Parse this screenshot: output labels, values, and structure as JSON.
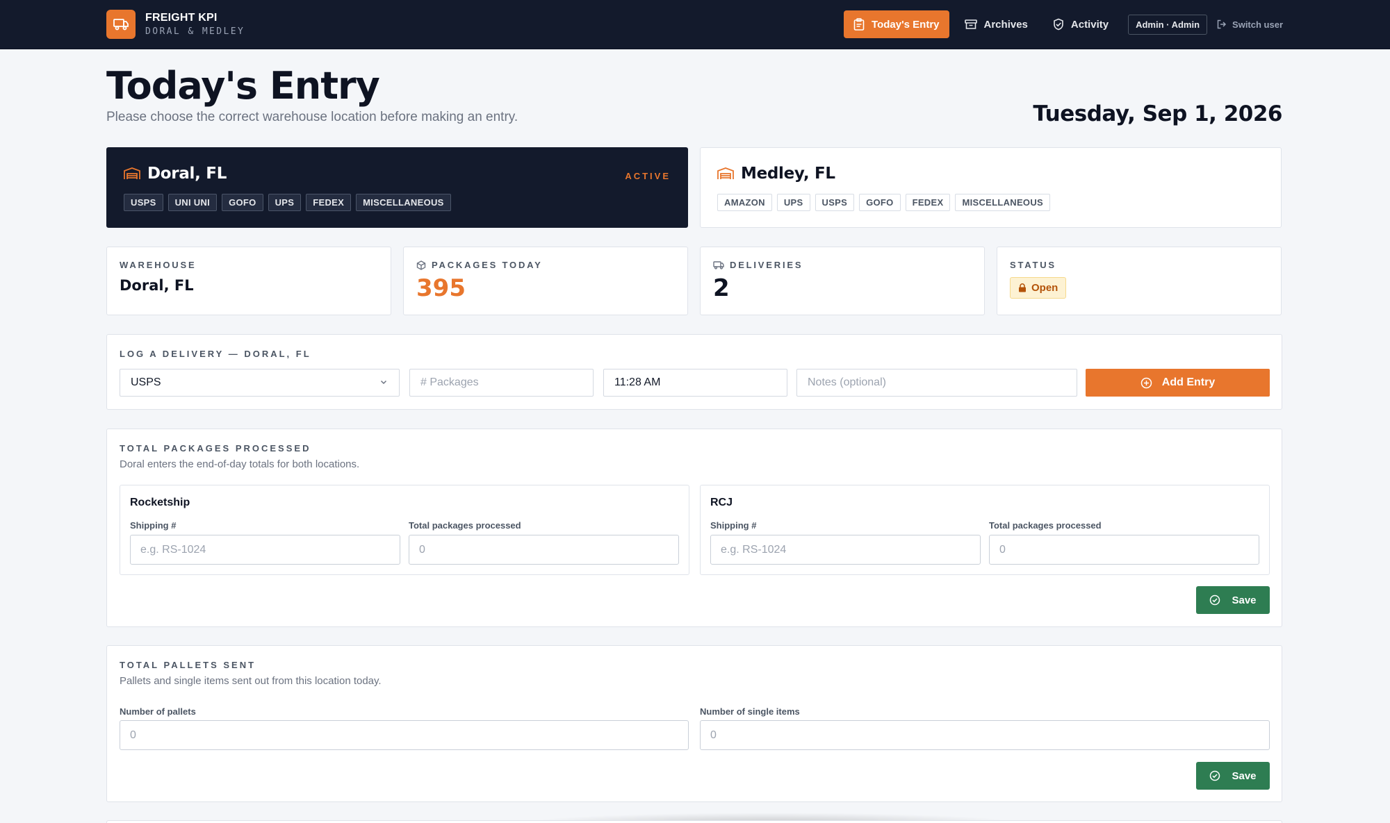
{
  "brand": {
    "title": "FREIGHT KPI",
    "subtitle": "DORAL & MEDLEY"
  },
  "nav": {
    "todays_entry": "Today's Entry",
    "archives": "Archives",
    "activity": "Activity",
    "user": "Admin · Admin",
    "switch_user": "Switch user"
  },
  "header": {
    "title": "Today's Entry",
    "subtitle": "Please choose the correct warehouse location before making an entry.",
    "date": "Tuesday, Sep 1, 2026"
  },
  "locations": [
    {
      "name": "Doral, FL",
      "status": "ACTIVE",
      "tags": [
        "USPS",
        "UNI UNI",
        "GOFO",
        "UPS",
        "FEDEX",
        "MISCELLANEOUS"
      ]
    },
    {
      "name": "Medley, FL",
      "tags": [
        "AMAZON",
        "UPS",
        "USPS",
        "GOFO",
        "FEDEX",
        "MISCELLANEOUS"
      ]
    }
  ],
  "stats": {
    "warehouse": {
      "label": "WAREHOUSE",
      "value": "Doral, FL"
    },
    "packages": {
      "label": "PACKAGES TODAY",
      "value": "395"
    },
    "deliveries": {
      "label": "DELIVERIES",
      "value": "2"
    },
    "status": {
      "label": "STATUS",
      "value": "Open"
    }
  },
  "log_delivery": {
    "title": "LOG A DELIVERY — DORAL, FL",
    "carrier_selected": "USPS",
    "packages_placeholder": "# Packages",
    "time_value": "11:28 AM",
    "notes_placeholder": "Notes (optional)",
    "add_button": "Add Entry"
  },
  "packages_processed": {
    "title": "TOTAL PACKAGES PROCESSED",
    "description": "Doral enters the end-of-day totals for both locations.",
    "cards": [
      {
        "name": "Rocketship",
        "shipping_label": "Shipping #",
        "shipping_placeholder": "e.g. RS-1024",
        "total_label": "Total packages processed",
        "total_placeholder": "0"
      },
      {
        "name": "RCJ",
        "shipping_label": "Shipping #",
        "shipping_placeholder": "e.g. RS-1024",
        "total_label": "Total packages processed",
        "total_placeholder": "0"
      }
    ],
    "save_button": "Save"
  },
  "pallets_sent": {
    "title": "TOTAL PALLETS SENT",
    "description": "Pallets and single items sent out from this location today.",
    "pallets_label": "Number of pallets",
    "pallets_placeholder": "0",
    "singles_label": "Number of single items",
    "singles_placeholder": "0",
    "save_button": "Save"
  },
  "colors": {
    "accent": "#e8762d",
    "navy": "#131a2c",
    "success": "#2e7d52",
    "warning_bg": "#fdf2d3"
  }
}
